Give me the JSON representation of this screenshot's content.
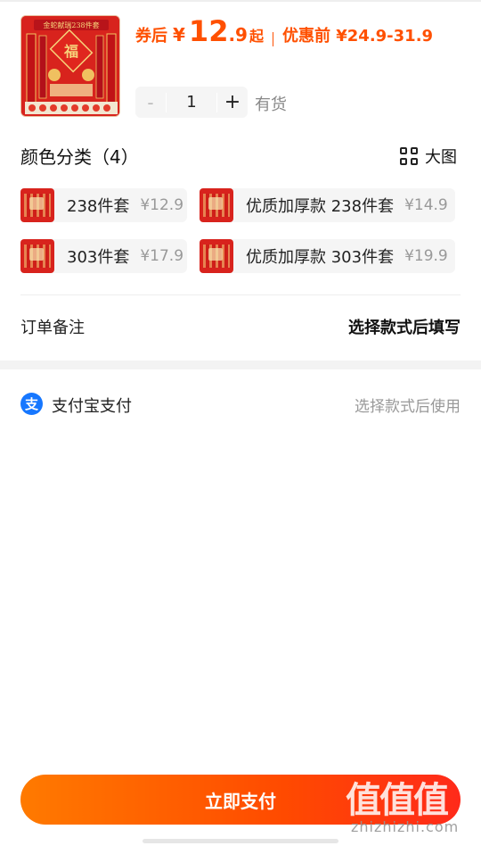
{
  "product": {
    "thumb_text": "金蛇献瑞238件套",
    "thumb_center": "福",
    "price_prefix": "券后",
    "currency": "¥",
    "price_int": "12",
    "price_dec": ".9",
    "price_suffix": "起",
    "original_price": "优惠前 ¥24.9-31.9",
    "quantity": "1",
    "minus": "-",
    "plus": "+",
    "stock": "有货"
  },
  "colors": {
    "title": "颜色分类（4）",
    "big_image_label": "大图",
    "options": [
      {
        "label": "238件套",
        "price": "¥12.9"
      },
      {
        "label": "优质加厚款 238件套",
        "price": "¥14.9"
      },
      {
        "label": "303件套",
        "price": "¥17.9"
      },
      {
        "label": "优质加厚款 303件套",
        "price": "¥19.9"
      }
    ]
  },
  "remark": {
    "label": "订单备注",
    "value": "选择款式后填写"
  },
  "payment": {
    "icon_glyph": "支",
    "label": "支付宝支付",
    "hint": "选择款式后使用"
  },
  "action": {
    "pay_now": "立即支付"
  },
  "watermark": {
    "main": "值值值",
    "sub": "zhizhizhi.com"
  },
  "colors_theme": {
    "accent": "#ff5000",
    "alipay": "#1677ff"
  }
}
